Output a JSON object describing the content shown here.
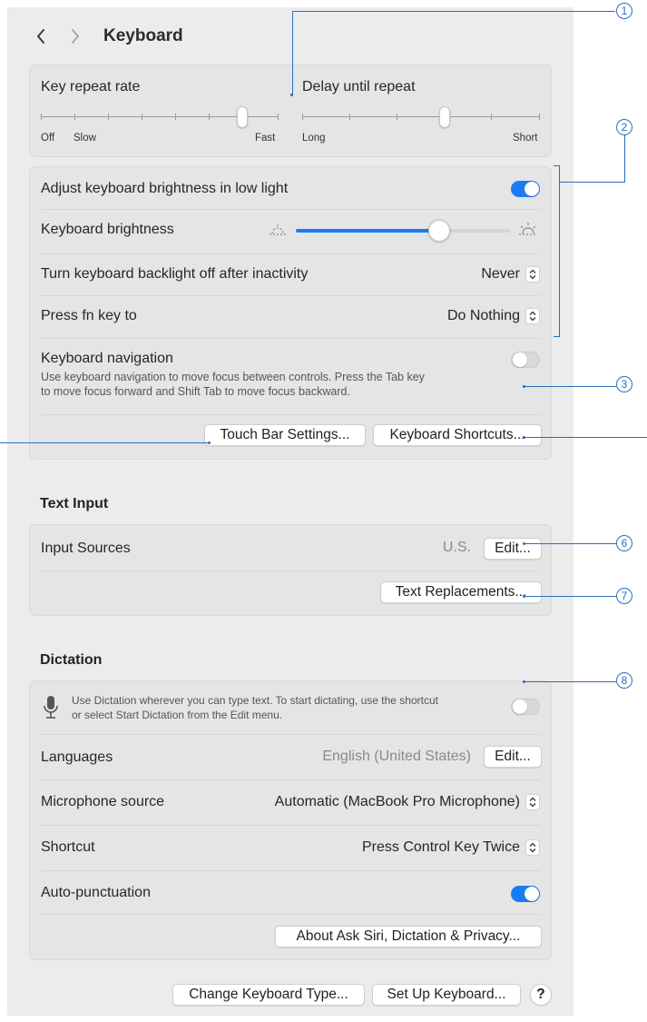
{
  "window": {
    "title": "Keyboard"
  },
  "repeat": {
    "key_repeat_label": "Key repeat rate",
    "key_repeat_min": "Off",
    "key_repeat_slow": "Slow",
    "key_repeat_max": "Fast",
    "key_repeat_value": 0.93,
    "delay_label": "Delay until repeat",
    "delay_min": "Long",
    "delay_max": "Short",
    "delay_value": 0.59
  },
  "backlight": {
    "adjust_label": "Adjust keyboard brightness in low light",
    "adjust_on": true,
    "brightness_label": "Keyboard brightness",
    "brightness_value": 0.66,
    "inactivity_label": "Turn keyboard backlight off after inactivity",
    "inactivity_value": "Never",
    "fn_label": "Press fn key to",
    "fn_value": "Do Nothing",
    "nav_label": "Keyboard navigation",
    "nav_on": false,
    "nav_desc_line1": "Use keyboard navigation to move focus between controls. Press the Tab key",
    "nav_desc_line2": "to move focus forward and Shift Tab to move focus backward.",
    "touchbar_button": "Touch Bar Settings...",
    "shortcuts_button": "Keyboard Shortcuts..."
  },
  "text_input": {
    "section_title": "Text Input",
    "sources_label": "Input Sources",
    "sources_value": "U.S.",
    "edit_button": "Edit...",
    "replacements_button": "Text Replacements..."
  },
  "dictation": {
    "section_title": "Dictation",
    "desc_line1": "Use Dictation wherever you can type text. To start dictating, use the shortcut",
    "desc_line2": "or select Start Dictation from the Edit menu.",
    "dictation_on": false,
    "languages_label": "Languages",
    "languages_value": "English (United States)",
    "languages_edit": "Edit...",
    "mic_label": "Microphone source",
    "mic_value": "Automatic (MacBook Pro Microphone)",
    "shortcut_label": "Shortcut",
    "shortcut_value": "Press Control Key Twice",
    "autopunct_label": "Auto-punctuation",
    "autopunct_on": true,
    "privacy_button": "About Ask Siri, Dictation & Privacy..."
  },
  "footer": {
    "change_type_button": "Change Keyboard Type...",
    "setup_button": "Set Up Keyboard...",
    "help_button": "?"
  },
  "callouts": [
    "1",
    "2",
    "3",
    "6",
    "7",
    "8"
  ],
  "colors": {
    "accent": "#1a7cf5",
    "callout": "#2a6fbd"
  }
}
